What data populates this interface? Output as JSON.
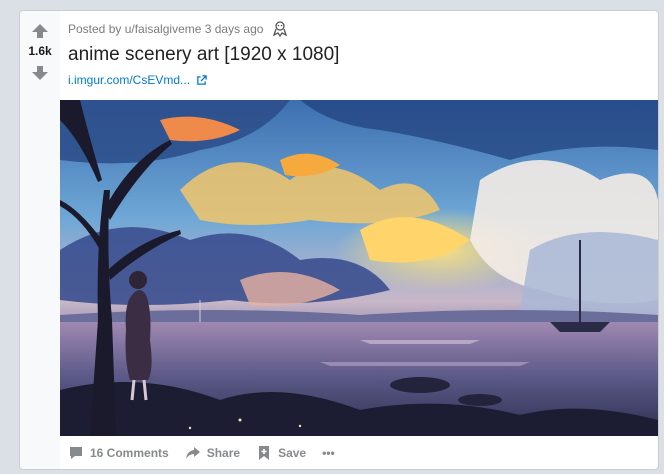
{
  "post": {
    "score": "1.6k",
    "posted_by": "Posted by u/faisalgiveme 3 days ago",
    "title": "anime scenery art [1920 x 1080]",
    "link_text": "i.imgur.com/CsEVmd...",
    "image_alt": "Anime scenery art: girl under a tree by a lake at sunset"
  },
  "actions": {
    "comments": "16 Comments",
    "share": "Share",
    "save": "Save",
    "more": "•••"
  },
  "colors": {
    "accent": "#0079d3",
    "vote_arrow": "#878a8c",
    "background": "#dae0e6"
  }
}
